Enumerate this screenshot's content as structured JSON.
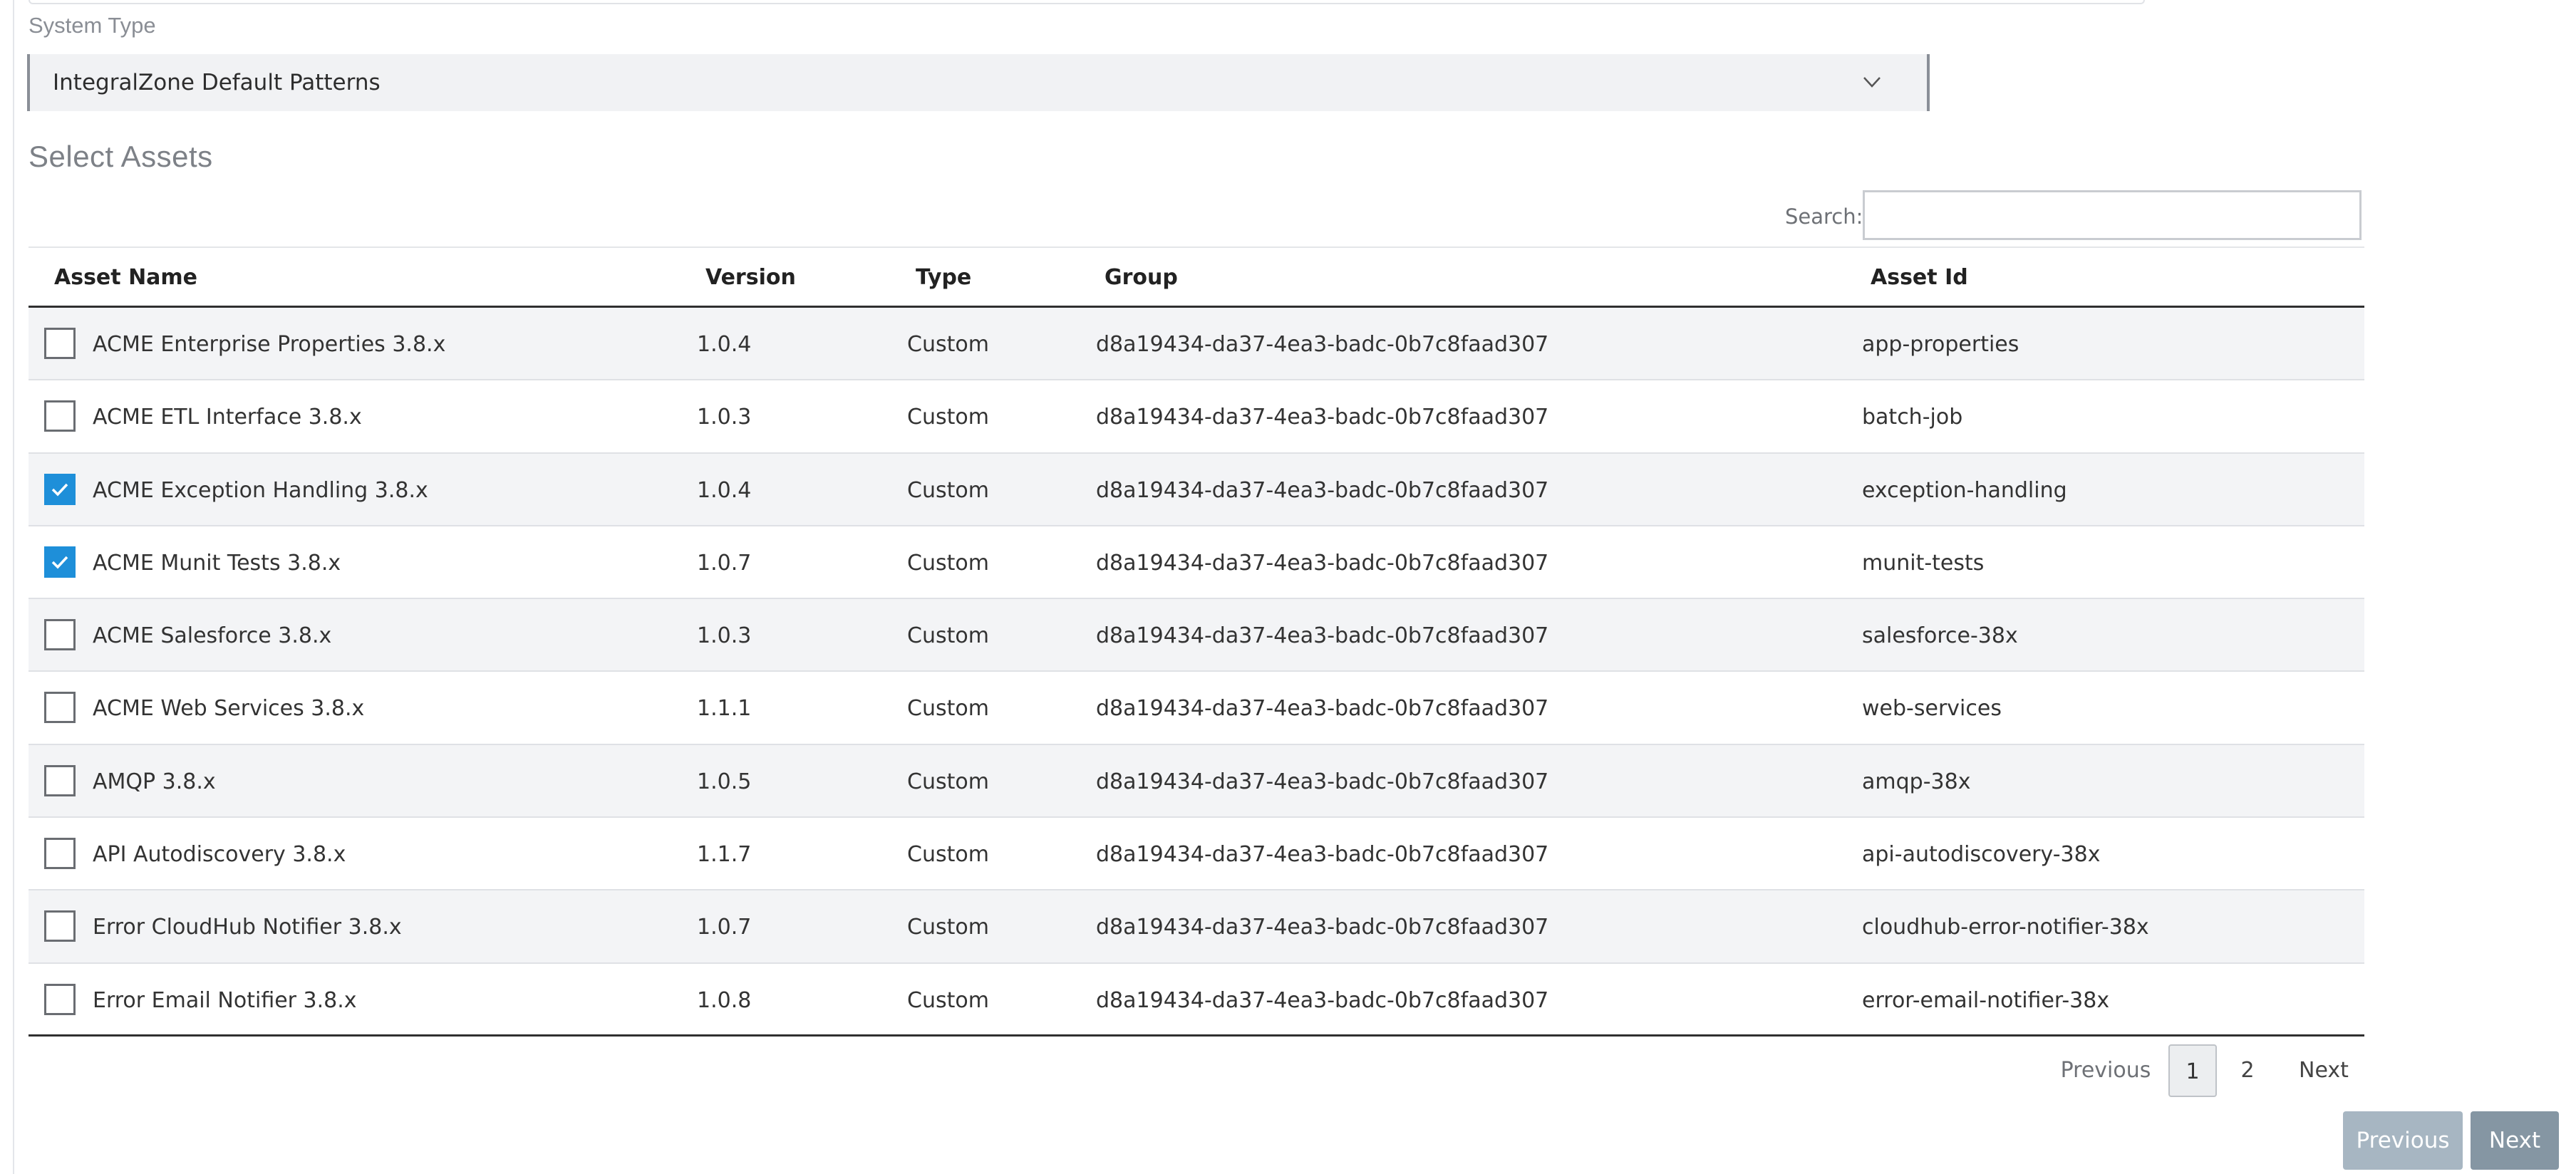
{
  "form": {
    "system_type_label": "System Type",
    "system_type_value": "IntegralZone Default Patterns",
    "section_title": "Select Assets",
    "search_label": "Search:",
    "search_value": ""
  },
  "table": {
    "headers": {
      "name": "Asset Name",
      "version": "Version",
      "type": "Type",
      "group": "Group",
      "asset_id": "Asset Id"
    },
    "rows": [
      {
        "name": "ACME Enterprise Properties 3.8.x",
        "version": "1.0.4",
        "type": "Custom",
        "group": "d8a19434-da37-4ea3-badc-0b7c8faad307",
        "asset_id": "app-properties",
        "checked": false
      },
      {
        "name": "ACME ETL Interface 3.8.x",
        "version": "1.0.3",
        "type": "Custom",
        "group": "d8a19434-da37-4ea3-badc-0b7c8faad307",
        "asset_id": "batch-job",
        "checked": false
      },
      {
        "name": "ACME Exception Handling 3.8.x",
        "version": "1.0.4",
        "type": "Custom",
        "group": "d8a19434-da37-4ea3-badc-0b7c8faad307",
        "asset_id": "exception-handling",
        "checked": true
      },
      {
        "name": "ACME Munit Tests 3.8.x",
        "version": "1.0.7",
        "type": "Custom",
        "group": "d8a19434-da37-4ea3-badc-0b7c8faad307",
        "asset_id": "munit-tests",
        "checked": true
      },
      {
        "name": "ACME Salesforce 3.8.x",
        "version": "1.0.3",
        "type": "Custom",
        "group": "d8a19434-da37-4ea3-badc-0b7c8faad307",
        "asset_id": "salesforce-38x",
        "checked": false
      },
      {
        "name": "ACME Web Services 3.8.x",
        "version": "1.1.1",
        "type": "Custom",
        "group": "d8a19434-da37-4ea3-badc-0b7c8faad307",
        "asset_id": "web-services",
        "checked": false
      },
      {
        "name": "AMQP 3.8.x",
        "version": "1.0.5",
        "type": "Custom",
        "group": "d8a19434-da37-4ea3-badc-0b7c8faad307",
        "asset_id": "amqp-38x",
        "checked": false
      },
      {
        "name": "API Autodiscovery 3.8.x",
        "version": "1.1.7",
        "type": "Custom",
        "group": "d8a19434-da37-4ea3-badc-0b7c8faad307",
        "asset_id": "api-autodiscovery-38x",
        "checked": false
      },
      {
        "name": "Error CloudHub Notifier 3.8.x",
        "version": "1.0.7",
        "type": "Custom",
        "group": "d8a19434-da37-4ea3-badc-0b7c8faad307",
        "asset_id": "cloudhub-error-notifier-38x",
        "checked": false
      },
      {
        "name": "Error Email Notifier 3.8.x",
        "version": "1.0.8",
        "type": "Custom",
        "group": "d8a19434-da37-4ea3-badc-0b7c8faad307",
        "asset_id": "error-email-notifier-38x",
        "checked": false
      }
    ]
  },
  "pagination": {
    "previous": "Previous",
    "pages": [
      "1",
      "2"
    ],
    "current_page": "1",
    "next": "Next"
  },
  "wizard": {
    "previous_label": "Previous",
    "next_label": "Next"
  },
  "colors": {
    "checkbox_checked": "#1e8fd9",
    "wizard_previous": "#a7b6c2",
    "wizard_next": "#8596a3"
  }
}
